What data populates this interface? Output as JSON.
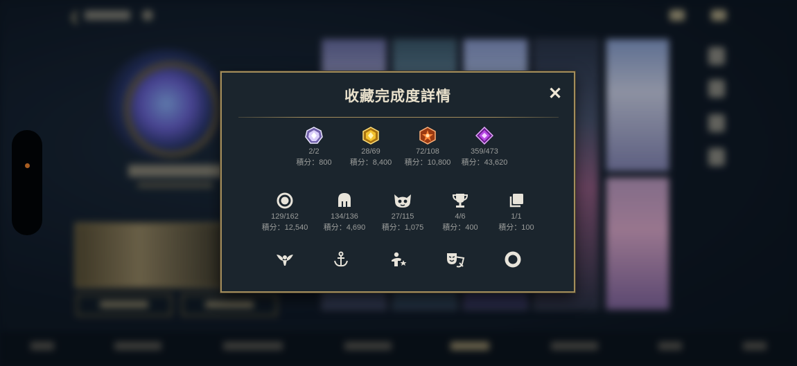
{
  "modal": {
    "title": "收藏完成度詳情",
    "close_glyph": "✕"
  },
  "gem_stats": [
    {
      "icon": "diamond-gem-icon",
      "color": "#c9b6f0",
      "count": "2/2",
      "score": "積分：800"
    },
    {
      "icon": "gold-gem-icon",
      "color": "#f2c12e",
      "count": "28/69",
      "score": "積分：8,400"
    },
    {
      "icon": "orange-star-gem-icon",
      "color": "#f07a2a",
      "count": "72/108",
      "score": "積分：10,800"
    },
    {
      "icon": "purple-gem-icon",
      "color": "#b845e6",
      "count": "359/473",
      "score": "積分：43,620"
    }
  ],
  "item_stats": [
    {
      "icon": "ring-icon",
      "count": "129/162",
      "score": "積分：12,540"
    },
    {
      "icon": "helmet-icon",
      "count": "134/136",
      "score": "積分：4,690"
    },
    {
      "icon": "poro-icon",
      "count": "27/115",
      "score": "積分：1,075"
    },
    {
      "icon": "trophy-icon",
      "count": "4/6",
      "score": "積分：400"
    },
    {
      "icon": "card-stack-icon",
      "count": "1/1",
      "score": "積分：100"
    }
  ],
  "bottom_icons": [
    "winged-emblem-icon",
    "anchor-icon",
    "champion-star-icon",
    "theater-mask-icon",
    "border-ring-icon"
  ],
  "background": {
    "back_glyph": "❮"
  },
  "colors": {
    "modal_border": "#a38d5c",
    "modal_bg": "#1b252d",
    "title_text": "#e9e1cc",
    "stat_text": "#9b9d9b",
    "icon_light": "#e8e4da"
  }
}
